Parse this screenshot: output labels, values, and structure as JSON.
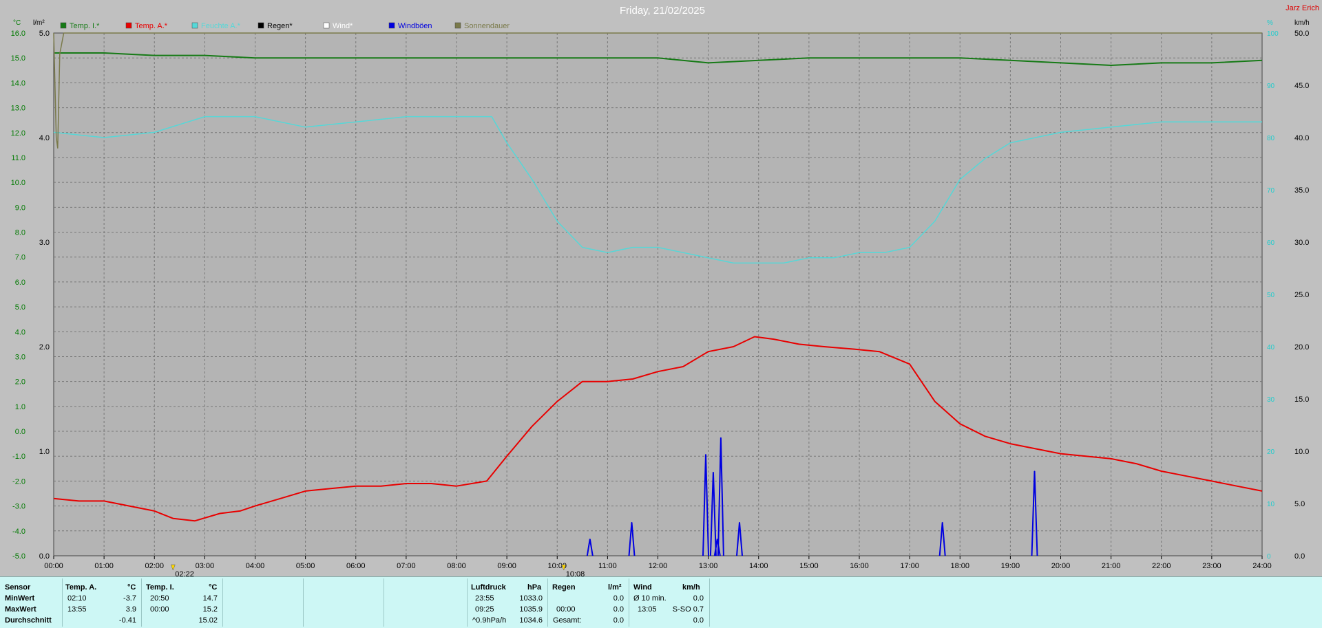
{
  "title": "Friday, 21/02/2025",
  "author": "Jarz Erich",
  "colors": {
    "background": "#b4b4b4",
    "grid": "#777777",
    "temp_inside": "#167a16",
    "temp_outside": "#e80000",
    "humidity": "#55d8d8",
    "rain": "#000000",
    "wind": "#ffffff",
    "gusts": "#0000e0",
    "sunshine": "#7a7a4a",
    "title": "#ffffff",
    "author": "#dd0000",
    "axis_temp": "#007a00",
    "axis_humidity": "#22cccc"
  },
  "axes": {
    "left_unit": "°C",
    "rain_unit": "l/m²",
    "right_unit_humidity": "%",
    "right_unit_wind": "km/h",
    "temp_ticks": [
      "16.0",
      "15.0",
      "14.0",
      "13.0",
      "12.0",
      "11.0",
      "10.0",
      "9.0",
      "8.0",
      "7.0",
      "6.0",
      "5.0",
      "4.0",
      "3.0",
      "2.0",
      "1.0",
      "0.0",
      "-1.0",
      "-2.0",
      "-3.0",
      "-4.0",
      "-5.0"
    ],
    "rain_ticks": [
      "5.0",
      "4.0",
      "3.0",
      "2.0",
      "1.0",
      "0.0"
    ],
    "humidity_ticks": [
      "100",
      "90",
      "80",
      "70",
      "60",
      "50",
      "40",
      "30",
      "20",
      "10",
      "0"
    ],
    "wind_ticks": [
      "50.0",
      "45.0",
      "40.0",
      "35.0",
      "30.0",
      "25.0",
      "20.0",
      "15.0",
      "10.0",
      "5.0",
      "0.0"
    ],
    "time_ticks": [
      "00:00",
      "01:00",
      "02:00",
      "03:00",
      "04:00",
      "05:00",
      "06:00",
      "07:00",
      "08:00",
      "09:00",
      "10:00",
      "11:00",
      "12:00",
      "13:00",
      "14:00",
      "15:00",
      "16:00",
      "17:00",
      "18:00",
      "19:00",
      "20:00",
      "21:00",
      "22:00",
      "23:00",
      "24:00"
    ],
    "markers": [
      {
        "time": 2.37,
        "label": "02:22"
      },
      {
        "time": 10.13,
        "label": "10:08"
      }
    ]
  },
  "legend": [
    {
      "label": "Temp. I.*",
      "color": "#167a16"
    },
    {
      "label": "Temp. A.*",
      "color": "#e80000"
    },
    {
      "label": "Feuchte A.*",
      "color": "#55d8d8"
    },
    {
      "label": "Regen*",
      "color": "#000000"
    },
    {
      "label": "Wind*",
      "color": "#ffffff"
    },
    {
      "label": "Windböen",
      "color": "#0000e0"
    },
    {
      "label": "Sonnendauer",
      "color": "#7a7a4a"
    }
  ],
  "chart_data": {
    "type": "line",
    "title": "Friday, 21/02/2025",
    "xlabel": "",
    "xlim": [
      0,
      24
    ],
    "ylim_temp": [
      -5,
      16
    ],
    "ylim_rain": [
      0,
      5
    ],
    "ylim_humidity": [
      0,
      100
    ],
    "ylim_wind": [
      0,
      50
    ],
    "grid": true,
    "legend_position": "top",
    "series": [
      {
        "name": "Temp. I.*",
        "axis": "temp",
        "x": [
          0,
          1,
          2,
          3,
          4,
          5,
          6,
          7,
          8,
          9,
          10,
          11,
          12,
          13,
          14,
          15,
          16,
          17,
          18,
          19,
          20,
          21,
          22,
          23,
          24
        ],
        "values": [
          15.2,
          15.2,
          15.1,
          15.1,
          15.0,
          15.0,
          15.0,
          15.0,
          15.0,
          15.0,
          15.0,
          15.0,
          15.0,
          14.8,
          14.9,
          15.0,
          15.0,
          15.0,
          15.0,
          14.9,
          14.8,
          14.7,
          14.8,
          14.8,
          14.9
        ]
      },
      {
        "name": "Temp. A.*",
        "axis": "temp",
        "x": [
          0,
          0.5,
          1,
          1.5,
          2,
          2.37,
          2.8,
          3.3,
          3.7,
          4.0,
          4.5,
          5.0,
          5.5,
          6.0,
          6.5,
          7.0,
          7.5,
          8.0,
          8.6,
          9.0,
          9.5,
          10.0,
          10.5,
          11.0,
          11.5,
          12.0,
          12.5,
          13.0,
          13.5,
          13.92,
          14.3,
          14.8,
          15.3,
          15.9,
          16.4,
          17.0,
          17.5,
          18.0,
          18.5,
          19.0,
          19.5,
          20.0,
          20.5,
          21.0,
          21.5,
          22.0,
          22.5,
          23.0,
          23.5,
          24.0
        ],
        "values": [
          -2.7,
          -2.8,
          -2.8,
          -3.0,
          -3.2,
          -3.5,
          -3.6,
          -3.3,
          -3.2,
          -3.0,
          -2.7,
          -2.4,
          -2.3,
          -2.2,
          -2.2,
          -2.1,
          -2.1,
          -2.2,
          -2.0,
          -1.0,
          0.2,
          1.2,
          2.0,
          2.0,
          2.1,
          2.4,
          2.6,
          3.2,
          3.4,
          3.8,
          3.7,
          3.5,
          3.4,
          3.3,
          3.2,
          2.7,
          1.2,
          0.3,
          -0.2,
          -0.5,
          -0.7,
          -0.9,
          -1.0,
          -1.1,
          -1.3,
          -1.6,
          -1.8,
          -2.0,
          -2.2,
          -2.4
        ]
      },
      {
        "name": "Feuchte A.*",
        "axis": "humidity",
        "x": [
          0,
          1,
          2,
          3,
          4,
          5,
          6,
          7,
          8,
          8.7,
          9,
          9.5,
          10,
          10.5,
          11,
          11.5,
          12,
          12.5,
          13,
          13.5,
          14,
          14.5,
          15,
          15.5,
          16,
          16.5,
          17,
          17.5,
          18,
          18.5,
          19,
          20,
          21,
          22,
          23,
          24
        ],
        "values": [
          81,
          80,
          81,
          84,
          84,
          82,
          83,
          84,
          84,
          84,
          79,
          72,
          64,
          59,
          58,
          59,
          59,
          58,
          57,
          56,
          56,
          56,
          57,
          57,
          58,
          58,
          59,
          64,
          72,
          76,
          79,
          81,
          82,
          83,
          83,
          83
        ]
      },
      {
        "name": "Windböen",
        "axis": "wind",
        "points": [
          {
            "x": 10.65,
            "y": 1.6
          },
          {
            "x": 11.48,
            "y": 3.2
          },
          {
            "x": 12.95,
            "y": 9.7
          },
          {
            "x": 13.1,
            "y": 8.0
          },
          {
            "x": 13.18,
            "y": 1.6
          },
          {
            "x": 13.25,
            "y": 11.3
          },
          {
            "x": 13.62,
            "y": 3.2
          },
          {
            "x": 17.65,
            "y": 3.2
          },
          {
            "x": 19.48,
            "y": 8.1
          }
        ]
      },
      {
        "name": "Sonnendauer",
        "axis": "rain",
        "note_values": "near 5.0 all day, dip to ~4.0 at 00:05",
        "x": [
          0,
          0.05,
          0.08,
          0.12,
          0.2,
          24
        ],
        "values": [
          5.0,
          4.0,
          3.9,
          4.8,
          5.0,
          5.0
        ]
      }
    ]
  },
  "stats": {
    "col_sensor": {
      "header": "Sensor",
      "rows": [
        "MinWert",
        "MaxWert",
        "Durchschnitt"
      ]
    },
    "temp_a": {
      "header": "Temp. A.",
      "unit": "°C",
      "min_time": "02:10",
      "min": "-3.7",
      "max_time": "13:55",
      "max": "3.9",
      "avg": "-0.41"
    },
    "temp_i": {
      "header": "Temp. I.",
      "unit": "°C",
      "min_time": "20:50",
      "min": "14.7",
      "max_time": "00:00",
      "max": "15.2",
      "avg": "15.02"
    },
    "pressure": {
      "header": "Luftdruck",
      "unit": "hPa",
      "min_time": "23:55",
      "min": "1033.0",
      "max_time": "09:25",
      "max": "1035.9",
      "trend": "^0.9hPa/h",
      "trend_val": "1034.6"
    },
    "rain": {
      "header": "Regen",
      "unit": "l/m²",
      "r1": "0.0",
      "r2_time": "00:00",
      "r2": "0.0",
      "total_label": "Gesamt:",
      "total": "0.0"
    },
    "wind": {
      "header": "Wind",
      "unit": "km/h",
      "avg_label": "Ø 10 min.",
      "avg": "0.0",
      "max_time": "13:05",
      "max_dir": "S-SO 0.7",
      "r3": "0.0"
    }
  }
}
